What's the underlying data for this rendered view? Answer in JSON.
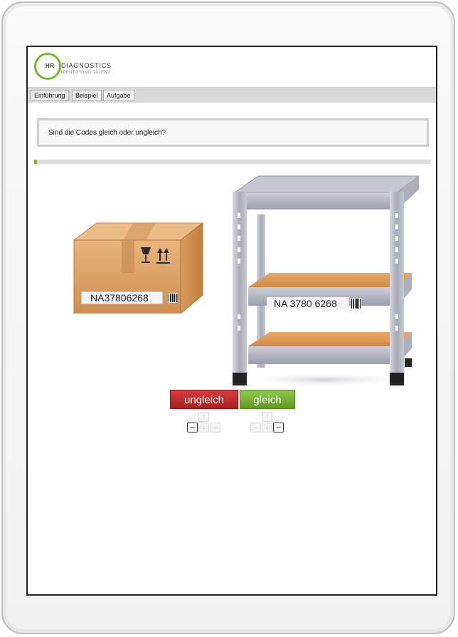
{
  "logo": {
    "mark": "HR",
    "name": "DIAGNOSTICS",
    "tagline": "IDENTIFYING TALENT",
    "brand_color": "#7ab531"
  },
  "tabs": [
    {
      "label": "Einführung"
    },
    {
      "label": "Beispiel"
    },
    {
      "label": "Aufgabe"
    }
  ],
  "question": "Sind die Codes gleich oder ungleich?",
  "progress": {
    "fraction": 0.008
  },
  "box": {
    "code": "NA37806268",
    "icons": [
      "fragile-glass-icon",
      "this-side-up-icon",
      "barcode-icon"
    ]
  },
  "shelf": {
    "code": "NA 3780 6268",
    "icons": [
      "barcode-icon"
    ]
  },
  "buttons": {
    "unequal": {
      "label": "ungleich",
      "color": "#c12b2b"
    },
    "equal": {
      "label": "gleich",
      "color": "#76b13a"
    }
  },
  "keys": {
    "left_group": {
      "up": "↑",
      "left": "–",
      "down": "↓",
      "right": "→",
      "highlight": "left"
    },
    "right_group": {
      "up": "↑",
      "left": "←",
      "down": "↓",
      "right": "–",
      "highlight": "right"
    }
  }
}
